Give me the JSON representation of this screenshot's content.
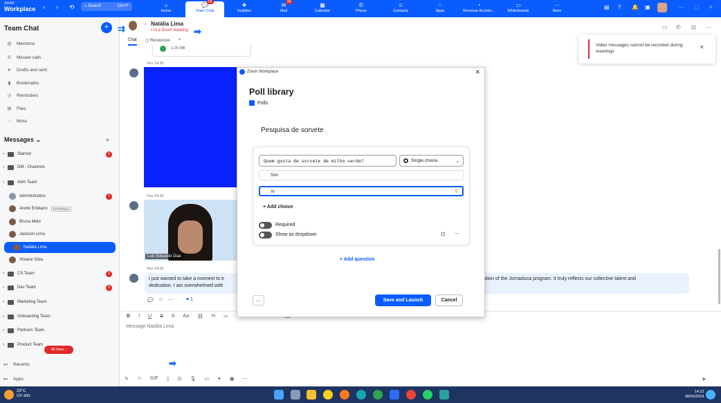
{
  "app": {
    "logo_top": "zoom",
    "logo_bottom": "Workplace",
    "search_placeholder": "Search",
    "search_shortcut": "Ctrl+F"
  },
  "nav": [
    {
      "label": "Home",
      "icon": "⌂",
      "badge": ""
    },
    {
      "label": "Team Chat",
      "icon": "💬",
      "badge": "55"
    },
    {
      "label": "Huddles",
      "icon": "❖",
      "badge": ""
    },
    {
      "label": "Mail",
      "icon": "✉",
      "badge": "24"
    },
    {
      "label": "Calendar",
      "icon": "▦",
      "badge": ""
    },
    {
      "label": "Phone",
      "icon": "✆",
      "badge": ""
    },
    {
      "label": "Contacts",
      "icon": "☺",
      "badge": ""
    },
    {
      "label": "Apps",
      "icon": "⁘",
      "badge": ""
    },
    {
      "label": "Revenue Acceler...",
      "icon": "◔",
      "badge": ""
    },
    {
      "label": "Whiteboards",
      "icon": "▭",
      "badge": ""
    },
    {
      "label": "More",
      "icon": "⋯",
      "badge": ""
    }
  ],
  "sidebar": {
    "title": "Team Chat",
    "items": [
      "Mentions",
      "Missed calls",
      "Drafts and sent",
      "Bookmarks",
      "Reminders",
      "Files",
      "More"
    ],
    "messages_title": "Messages",
    "list": [
      {
        "label": "Starred",
        "type": "folder",
        "count": "5"
      },
      {
        "label": "DM - Channels",
        "type": "folder",
        "count": ""
      },
      {
        "label": "Adm Team",
        "type": "folder",
        "count": ""
      },
      {
        "label": "Administrativo",
        "type": "channel",
        "count": "1"
      },
      {
        "label": "André Emiliano",
        "type": "person",
        "count": "",
        "tag": "EXTERNAL"
      },
      {
        "label": "Bruna Melo",
        "type": "person",
        "count": ""
      },
      {
        "label": "Jackson Lima",
        "type": "person",
        "count": ""
      },
      {
        "label": "Natália Lima",
        "type": "person",
        "count": "",
        "selected": true
      },
      {
        "label": "Viviane Silva",
        "type": "person",
        "count": ""
      },
      {
        "label": "CS Team",
        "type": "folder",
        "count": "2"
      },
      {
        "label": "Dev Team",
        "type": "folder",
        "count": "3"
      },
      {
        "label": "Marketing Team",
        "type": "folder",
        "count": ""
      },
      {
        "label": "Onboarding Team",
        "type": "folder",
        "count": ""
      },
      {
        "label": "Partners Team",
        "type": "folder",
        "count": ""
      },
      {
        "label": "Product Team",
        "type": "folder",
        "count": ""
      }
    ],
    "new_pill": "46 New ↓",
    "recents": "Recents",
    "apps": "Apps"
  },
  "chat": {
    "name": "Natália Lima",
    "status": "In a Zoom meeting",
    "tab_chat": "Chat",
    "tab_resources": "Resources",
    "file_size": "2.25 MB",
    "msg1_time": "You 14:20",
    "msg2_time": "You 14:20",
    "video_name": "Luiz Eduardo Dias",
    "msg3_time": "You 14:22",
    "msg3_text_a": "I just wanted to take a moment to e",
    "msg3_text_b": "dedication. I am overwhelmed with",
    "msg3_text_c": "creation of the Jornaduca program. It truly reflects our collective talent and",
    "reaction_count": "1",
    "composer_placeholder": "Message Natália Lima"
  },
  "dialog": {
    "window_title": "Zoom Workplace",
    "title": "Poll library",
    "tag": "Polls",
    "poll_name": "Pesquisa de sorvete",
    "question": "Quem gosta de sorvete de milho verde?",
    "type": "Single choice",
    "choice1": "Sim",
    "choice2": "N",
    "add_choice": "Add choice",
    "required": "Required",
    "dropdown": "Show as dropdown",
    "add_question": "Add question",
    "more": "...",
    "save": "Save and Launch",
    "cancel": "Cancel"
  },
  "toast": {
    "text": "Video messages cannot be recorded during meetings"
  },
  "taskbar": {
    "temp": "29°C",
    "weather": "UV alto",
    "time": "14:22",
    "date": "08/05/2024"
  },
  "colors": {
    "accent": "#0b5cff",
    "badge": "#e02828",
    "taskbar": "#1e3462"
  }
}
